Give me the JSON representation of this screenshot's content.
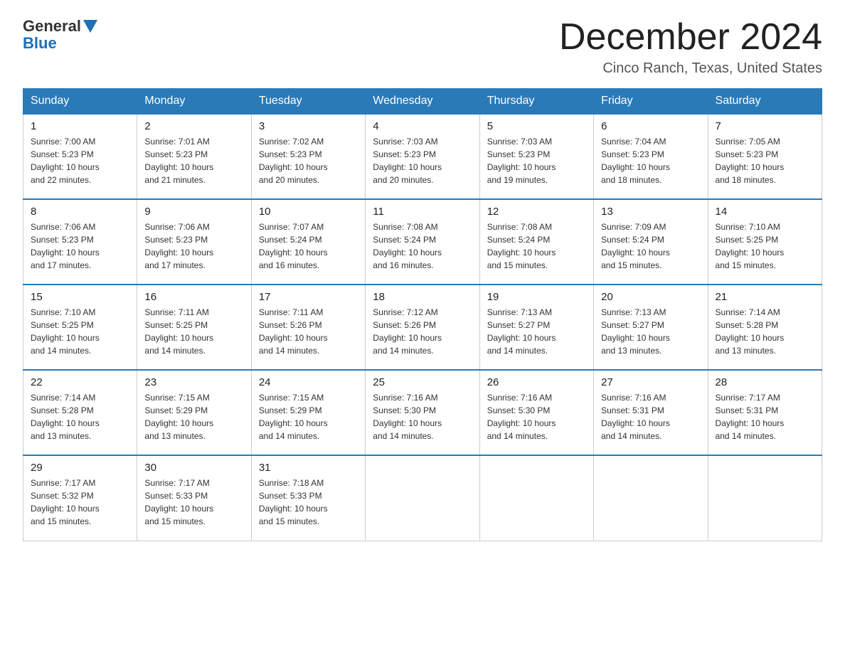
{
  "header": {
    "logo_general": "General",
    "logo_blue": "Blue",
    "month_title": "December 2024",
    "location": "Cinco Ranch, Texas, United States"
  },
  "days_of_week": [
    "Sunday",
    "Monday",
    "Tuesday",
    "Wednesday",
    "Thursday",
    "Friday",
    "Saturday"
  ],
  "weeks": [
    [
      {
        "day": "1",
        "sunrise": "7:00 AM",
        "sunset": "5:23 PM",
        "daylight": "10 hours and 22 minutes."
      },
      {
        "day": "2",
        "sunrise": "7:01 AM",
        "sunset": "5:23 PM",
        "daylight": "10 hours and 21 minutes."
      },
      {
        "day": "3",
        "sunrise": "7:02 AM",
        "sunset": "5:23 PM",
        "daylight": "10 hours and 20 minutes."
      },
      {
        "day": "4",
        "sunrise": "7:03 AM",
        "sunset": "5:23 PM",
        "daylight": "10 hours and 20 minutes."
      },
      {
        "day": "5",
        "sunrise": "7:03 AM",
        "sunset": "5:23 PM",
        "daylight": "10 hours and 19 minutes."
      },
      {
        "day": "6",
        "sunrise": "7:04 AM",
        "sunset": "5:23 PM",
        "daylight": "10 hours and 18 minutes."
      },
      {
        "day": "7",
        "sunrise": "7:05 AM",
        "sunset": "5:23 PM",
        "daylight": "10 hours and 18 minutes."
      }
    ],
    [
      {
        "day": "8",
        "sunrise": "7:06 AM",
        "sunset": "5:23 PM",
        "daylight": "10 hours and 17 minutes."
      },
      {
        "day": "9",
        "sunrise": "7:06 AM",
        "sunset": "5:23 PM",
        "daylight": "10 hours and 17 minutes."
      },
      {
        "day": "10",
        "sunrise": "7:07 AM",
        "sunset": "5:24 PM",
        "daylight": "10 hours and 16 minutes."
      },
      {
        "day": "11",
        "sunrise": "7:08 AM",
        "sunset": "5:24 PM",
        "daylight": "10 hours and 16 minutes."
      },
      {
        "day": "12",
        "sunrise": "7:08 AM",
        "sunset": "5:24 PM",
        "daylight": "10 hours and 15 minutes."
      },
      {
        "day": "13",
        "sunrise": "7:09 AM",
        "sunset": "5:24 PM",
        "daylight": "10 hours and 15 minutes."
      },
      {
        "day": "14",
        "sunrise": "7:10 AM",
        "sunset": "5:25 PM",
        "daylight": "10 hours and 15 minutes."
      }
    ],
    [
      {
        "day": "15",
        "sunrise": "7:10 AM",
        "sunset": "5:25 PM",
        "daylight": "10 hours and 14 minutes."
      },
      {
        "day": "16",
        "sunrise": "7:11 AM",
        "sunset": "5:25 PM",
        "daylight": "10 hours and 14 minutes."
      },
      {
        "day": "17",
        "sunrise": "7:11 AM",
        "sunset": "5:26 PM",
        "daylight": "10 hours and 14 minutes."
      },
      {
        "day": "18",
        "sunrise": "7:12 AM",
        "sunset": "5:26 PM",
        "daylight": "10 hours and 14 minutes."
      },
      {
        "day": "19",
        "sunrise": "7:13 AM",
        "sunset": "5:27 PM",
        "daylight": "10 hours and 14 minutes."
      },
      {
        "day": "20",
        "sunrise": "7:13 AM",
        "sunset": "5:27 PM",
        "daylight": "10 hours and 13 minutes."
      },
      {
        "day": "21",
        "sunrise": "7:14 AM",
        "sunset": "5:28 PM",
        "daylight": "10 hours and 13 minutes."
      }
    ],
    [
      {
        "day": "22",
        "sunrise": "7:14 AM",
        "sunset": "5:28 PM",
        "daylight": "10 hours and 13 minutes."
      },
      {
        "day": "23",
        "sunrise": "7:15 AM",
        "sunset": "5:29 PM",
        "daylight": "10 hours and 13 minutes."
      },
      {
        "day": "24",
        "sunrise": "7:15 AM",
        "sunset": "5:29 PM",
        "daylight": "10 hours and 14 minutes."
      },
      {
        "day": "25",
        "sunrise": "7:16 AM",
        "sunset": "5:30 PM",
        "daylight": "10 hours and 14 minutes."
      },
      {
        "day": "26",
        "sunrise": "7:16 AM",
        "sunset": "5:30 PM",
        "daylight": "10 hours and 14 minutes."
      },
      {
        "day": "27",
        "sunrise": "7:16 AM",
        "sunset": "5:31 PM",
        "daylight": "10 hours and 14 minutes."
      },
      {
        "day": "28",
        "sunrise": "7:17 AM",
        "sunset": "5:31 PM",
        "daylight": "10 hours and 14 minutes."
      }
    ],
    [
      {
        "day": "29",
        "sunrise": "7:17 AM",
        "sunset": "5:32 PM",
        "daylight": "10 hours and 15 minutes."
      },
      {
        "day": "30",
        "sunrise": "7:17 AM",
        "sunset": "5:33 PM",
        "daylight": "10 hours and 15 minutes."
      },
      {
        "day": "31",
        "sunrise": "7:18 AM",
        "sunset": "5:33 PM",
        "daylight": "10 hours and 15 minutes."
      },
      null,
      null,
      null,
      null
    ]
  ]
}
